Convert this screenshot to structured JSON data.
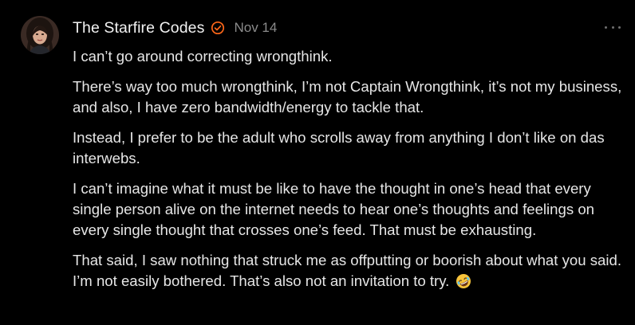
{
  "comment": {
    "author": "The Starfire Codes",
    "date": "Nov 14",
    "verified_icon": "check-badge-icon",
    "more_icon": "ellipsis-icon",
    "colors": {
      "background": "#000000",
      "text": "#e6e6e6",
      "muted": "#8b8b8b",
      "accent": "#ff6719"
    },
    "paragraphs": [
      "I can’t go around correcting wrongthink.",
      "There’s way too much wrongthink, I’m not Captain Wrongthink, it’s not my business, and also, I have zero bandwidth/energy to tackle that.",
      "Instead, I prefer to be the adult who scrolls away from anything I don’t like on das interwebs.",
      "I can’t imagine what it must be like to have the thought in one’s head that every single person alive on the internet needs to hear one’s thoughts and feelings on every single thought that crosses one’s feed. That must be exhausting.",
      "That said, I saw nothing that struck me as offputting or boorish about what you said. I’m not easily bothered. That’s also not an invitation to try."
    ],
    "emoji": "rolling-on-floor-laughing-emoji"
  }
}
